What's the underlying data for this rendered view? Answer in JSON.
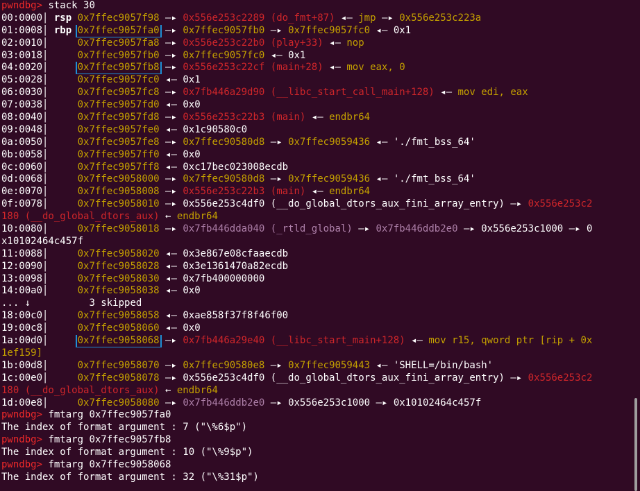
{
  "prompt": "pwndbg>",
  "lines": [
    {
      "k": "cmd",
      "cmd": "stack 30"
    },
    {
      "k": "stk",
      "idx": "00:0000",
      "reg": "rsp",
      "addr": "0x7ffec9057f98",
      "boxed": false,
      "chain": [
        {
          "v": "0x556e253c2289 (do_fmt+87)",
          "c": "red"
        },
        {
          "v": "jmp",
          "c": "grn"
        },
        {
          "v": "0x556e253c223a",
          "c": "yel"
        }
      ]
    },
    {
      "k": "stk",
      "idx": "01:0008",
      "reg": "rbp",
      "addr": "0x7ffec9057fa0",
      "boxed": true,
      "chain": [
        {
          "v": "0x7ffec9057fb0",
          "c": "yel"
        },
        {
          "v": "0x7ffec9057fc0",
          "c": "yel"
        },
        {
          "v": "0x1",
          "c": "wht"
        }
      ]
    },
    {
      "k": "stk",
      "idx": "02:0010",
      "reg": "",
      "addr": "0x7ffec9057fa8",
      "boxed": false,
      "chain": [
        {
          "v": "0x556e253c22b0 (play+33)",
          "c": "red"
        },
        {
          "v": "nop",
          "c": "grn"
        }
      ]
    },
    {
      "k": "stk",
      "idx": "03:0018",
      "reg": "",
      "addr": "0x7ffec9057fb0",
      "boxed": false,
      "chain": [
        {
          "v": "0x7ffec9057fc0",
          "c": "yel"
        },
        {
          "v": "0x1",
          "c": "wht"
        }
      ]
    },
    {
      "k": "stk",
      "idx": "04:0020",
      "reg": "",
      "addr": "0x7ffec9057fb8",
      "boxed": true,
      "chain": [
        {
          "v": "0x556e253c22cf (main+28)",
          "c": "red"
        },
        {
          "v": "mov eax, 0",
          "c": "grn"
        }
      ]
    },
    {
      "k": "stk",
      "idx": "05:0028",
      "reg": "",
      "addr": "0x7ffec9057fc0",
      "boxed": false,
      "chain": [
        {
          "v": "0x1",
          "c": "wht"
        }
      ]
    },
    {
      "k": "stk",
      "idx": "06:0030",
      "reg": "",
      "addr": "0x7ffec9057fc8",
      "boxed": false,
      "chain": [
        {
          "v": "0x7fb446a29d90 (__libc_start_call_main+128)",
          "c": "red"
        },
        {
          "v": "mov edi, eax",
          "c": "grn"
        }
      ]
    },
    {
      "k": "stk",
      "idx": "07:0038",
      "reg": "",
      "addr": "0x7ffec9057fd0",
      "boxed": false,
      "chain": [
        {
          "v": "0x0",
          "c": "wht"
        }
      ]
    },
    {
      "k": "stk",
      "idx": "08:0040",
      "reg": "",
      "addr": "0x7ffec9057fd8",
      "boxed": false,
      "chain": [
        {
          "v": "0x556e253c22b3 (main)",
          "c": "red"
        },
        {
          "v": "endbr64",
          "c": "grn"
        }
      ]
    },
    {
      "k": "stk",
      "idx": "09:0048",
      "reg": "",
      "addr": "0x7ffec9057fe0",
      "boxed": false,
      "chain": [
        {
          "v": "0x1c90580c0",
          "c": "wht"
        }
      ]
    },
    {
      "k": "stk",
      "idx": "0a:0050",
      "reg": "",
      "addr": "0x7ffec9057fe8",
      "boxed": false,
      "chain": [
        {
          "v": "0x7ffec90580d8",
          "c": "yel"
        },
        {
          "v": "0x7ffec9059436",
          "c": "yel"
        },
        {
          "v": "'./fmt_bss_64'",
          "c": "wht"
        }
      ]
    },
    {
      "k": "stk",
      "idx": "0b:0058",
      "reg": "",
      "addr": "0x7ffec9057ff0",
      "boxed": false,
      "chain": [
        {
          "v": "0x0",
          "c": "wht"
        }
      ]
    },
    {
      "k": "stk",
      "idx": "0c:0060",
      "reg": "",
      "addr": "0x7ffec9057ff8",
      "boxed": false,
      "chain": [
        {
          "v": "0xc17bec023008ecdb",
          "c": "wht"
        }
      ]
    },
    {
      "k": "stk",
      "idx": "0d:0068",
      "reg": "",
      "addr": "0x7ffec9058000",
      "boxed": false,
      "chain": [
        {
          "v": "0x7ffec90580d8",
          "c": "yel"
        },
        {
          "v": "0x7ffec9059436",
          "c": "yel"
        },
        {
          "v": "'./fmt_bss_64'",
          "c": "wht"
        }
      ]
    },
    {
      "k": "stk",
      "idx": "0e:0070",
      "reg": "",
      "addr": "0x7ffec9058008",
      "boxed": false,
      "chain": [
        {
          "v": "0x556e253c22b3 (main)",
          "c": "red"
        },
        {
          "v": "endbr64",
          "c": "grn"
        }
      ]
    },
    {
      "k": "stk",
      "idx": "0f:0078",
      "reg": "",
      "addr": "0x7ffec9058010",
      "boxed": false,
      "chain": [
        {
          "v": "0x556e253c4df0 (__do_global_dtors_aux_fini_array_entry)",
          "c": "wht"
        },
        {
          "v": "0x556e253c2",
          "c": "red"
        }
      ]
    },
    {
      "k": "wrap",
      "segs": [
        {
          "v": "180 (__do_global_dtors_aux)",
          "c": "red"
        },
        {
          "v": " ← ",
          "c": "wht"
        },
        {
          "v": "endbr64",
          "c": "grn"
        }
      ]
    },
    {
      "k": "stk",
      "idx": "10:0080",
      "reg": "",
      "addr": "0x7ffec9058018",
      "boxed": false,
      "chain": [
        {
          "v": "0x7fb446dda040 (_rtld_global)",
          "c": "mag"
        },
        {
          "v": "0x7fb446ddb2e0",
          "c": "mag"
        },
        {
          "v": "0x556e253c1000",
          "c": "wht"
        },
        {
          "v": "0",
          "c": "wht"
        }
      ]
    },
    {
      "k": "wrap",
      "segs": [
        {
          "v": "x10102464c457f",
          "c": "wht"
        }
      ]
    },
    {
      "k": "stk",
      "idx": "11:0088",
      "reg": "",
      "addr": "0x7ffec9058020",
      "boxed": false,
      "chain": [
        {
          "v": "0x3e867e08cfaaecdb",
          "c": "wht"
        }
      ]
    },
    {
      "k": "stk",
      "idx": "12:0090",
      "reg": "",
      "addr": "0x7ffec9058028",
      "boxed": false,
      "chain": [
        {
          "v": "0x3e1361470a82ecdb",
          "c": "wht"
        }
      ]
    },
    {
      "k": "stk",
      "idx": "13:0098",
      "reg": "",
      "addr": "0x7ffec9058030",
      "boxed": false,
      "chain": [
        {
          "v": "0x7fb400000000",
          "c": "wht"
        }
      ]
    },
    {
      "k": "stk",
      "idx": "14:00a0",
      "reg": "",
      "addr": "0x7ffec9058038",
      "boxed": false,
      "chain": [
        {
          "v": "0x0",
          "c": "wht"
        }
      ]
    },
    {
      "k": "skip",
      "idx": "... ↓",
      "text": "3 skipped"
    },
    {
      "k": "stk",
      "idx": "18:00c0",
      "reg": "",
      "addr": "0x7ffec9058058",
      "boxed": false,
      "chain": [
        {
          "v": "0xae858f37f8f46f00",
          "c": "wht"
        }
      ]
    },
    {
      "k": "stk",
      "idx": "19:00c8",
      "reg": "",
      "addr": "0x7ffec9058060",
      "boxed": false,
      "chain": [
        {
          "v": "0x0",
          "c": "wht"
        }
      ]
    },
    {
      "k": "stk",
      "idx": "1a:00d0",
      "reg": "",
      "addr": "0x7ffec9058068",
      "boxed": true,
      "chain": [
        {
          "v": "0x7fb446a29e40 (__libc_start_main+128)",
          "c": "red"
        },
        {
          "v": "mov r15, qword ptr [rip + 0x",
          "c": "grn"
        }
      ]
    },
    {
      "k": "wrap",
      "segs": [
        {
          "v": "1ef159]",
          "c": "grn"
        }
      ]
    },
    {
      "k": "stk",
      "idx": "1b:00d8",
      "reg": "",
      "addr": "0x7ffec9058070",
      "boxed": false,
      "chain": [
        {
          "v": "0x7ffec90580e8",
          "c": "yel"
        },
        {
          "v": "0x7ffec9059443",
          "c": "yel"
        },
        {
          "v": "'SHELL=/bin/bash'",
          "c": "wht"
        }
      ]
    },
    {
      "k": "stk",
      "idx": "1c:00e0",
      "reg": "",
      "addr": "0x7ffec9058078",
      "boxed": false,
      "chain": [
        {
          "v": "0x556e253c4df0 (__do_global_dtors_aux_fini_array_entry)",
          "c": "wht"
        },
        {
          "v": "0x556e253c2",
          "c": "red"
        }
      ]
    },
    {
      "k": "wrap",
      "segs": [
        {
          "v": "180 (__do_global_dtors_aux)",
          "c": "red"
        },
        {
          "v": " ← ",
          "c": "wht"
        },
        {
          "v": "endbr64",
          "c": "grn"
        }
      ]
    },
    {
      "k": "stk",
      "idx": "1d:00e8",
      "reg": "",
      "addr": "0x7ffec9058080",
      "boxed": false,
      "chain": [
        {
          "v": "0x7fb446ddb2e0",
          "c": "mag"
        },
        {
          "v": "0x556e253c1000",
          "c": "wht"
        },
        {
          "v": "0x10102464c457f",
          "c": "wht"
        }
      ]
    },
    {
      "k": "cmd",
      "cmd": "fmtarg 0x7ffec9057fa0"
    },
    {
      "k": "out",
      "text": "The index of format argument : 7 (\"\\%6$p\")"
    },
    {
      "k": "cmd",
      "cmd": "fmtarg 0x7ffec9057fb8"
    },
    {
      "k": "out",
      "text": "The index of format argument : 10 (\"\\%9$p\")"
    },
    {
      "k": "cmd",
      "cmd": "fmtarg 0x7ffec9058068"
    },
    {
      "k": "out",
      "text": "The index of format argument : 32 (\"\\%31$p\")"
    }
  ]
}
